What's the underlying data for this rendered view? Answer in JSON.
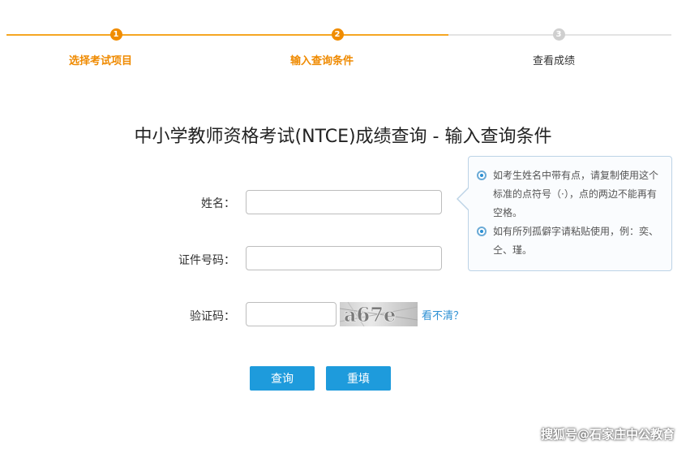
{
  "steps": [
    {
      "number": "1",
      "label": "选择考试项目",
      "state": "done"
    },
    {
      "number": "2",
      "label": "输入查询条件",
      "state": "active"
    },
    {
      "number": "3",
      "label": "查看成绩",
      "state": "pending"
    }
  ],
  "title": "中小学教师资格考试(NTCE)成绩查询 - 输入查询条件",
  "form": {
    "name_label": "姓名：",
    "name_value": "",
    "id_label": "证件号码：",
    "id_value": "",
    "code_label": "验证码：",
    "code_value": "",
    "captcha_text": "a67e",
    "refresh_link": "看不清？"
  },
  "tip": {
    "items": [
      "如考生姓名中带有点，请复制使用这个标准的点符号（·），点的两边不能再有空格。",
      "如有所列孤僻字请粘贴使用，例：奕、仝、瑾。"
    ]
  },
  "buttons": {
    "query": "查询",
    "reset": "重填"
  },
  "watermark": "搜狐号@石家庄中公教育",
  "colors": {
    "accent_orange": "#f08c00",
    "button_blue": "#1e9bdc",
    "link_blue": "#2b8fd3"
  }
}
